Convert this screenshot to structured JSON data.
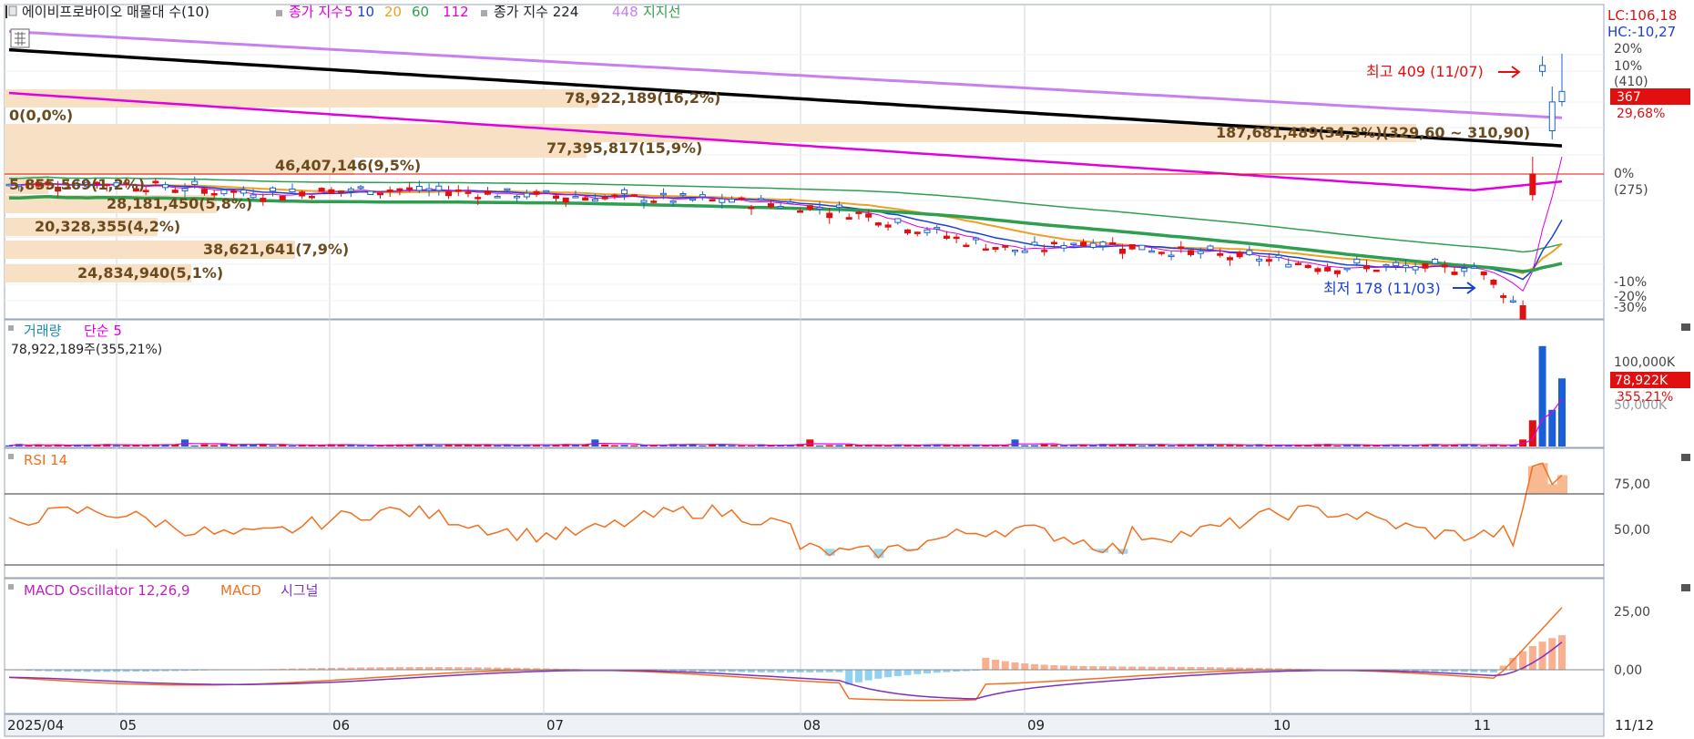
{
  "header": {
    "stock_name": "에이비프로바이오 매물대 수(10)",
    "ma_label": "종가 지수",
    "ma_periods": [
      "5",
      "10",
      "20",
      "60",
      "112"
    ],
    "ma_colors": [
      "#e000e0",
      "#1b3fd6",
      "#f0a020",
      "#2e9f4e",
      "#e000e0"
    ],
    "ma2_label": "종가 지수 224",
    "ma2_extra": "448",
    "support_label": "지지선",
    "lc": "LC:106,18",
    "hc": "HC:-10,27"
  },
  "colors": {
    "up": "#e01010",
    "down": "#1b5fd6",
    "grid": "#d0d6e0",
    "volume_profile": "#f7e0c4",
    "ma5": "#e000e0",
    "ma10": "#1b3fd6",
    "ma20": "#f0a020",
    "ma60": "#2e9f4e",
    "ma112": "#e000e0",
    "ma224": "#000000",
    "ma448": "#c880f0",
    "support": "#2e9f4e",
    "rsi": "#f07020",
    "macd": "#f07020",
    "signal": "#8030c0",
    "osc_pos": "#f8b090",
    "osc_neg": "#90d0f0"
  },
  "price_panel": {
    "volume_profile": [
      {
        "label": "0(0,0%)",
        "value": 0
      },
      {
        "label": "78,922,189(16,2%)",
        "value": 78922189
      },
      {
        "label": "187,681,489(34,3%)(329,60 ~ 310,90)",
        "value": 187681489
      },
      {
        "label": "77,395,817(15,9%)",
        "value": 77395817
      },
      {
        "label": "46,407,146(9,5%)",
        "value": 46407146
      },
      {
        "label": "5,855,569(1,2%)",
        "value": 5855569
      },
      {
        "label": "28,181,450(5,8%)",
        "value": 28181450
      },
      {
        "label": "20,328,355(4,2%)",
        "value": 20328355
      },
      {
        "label": "38,621,641(7,9%)",
        "value": 38621641
      },
      {
        "label": "24,834,940(5,1%)",
        "value": 24834940
      }
    ],
    "high_marker": "최고 409 (11/07)",
    "low_marker": "최저 178 (11/03)",
    "axis_labels": [
      "20%",
      "10%",
      "(410)",
      "29,68%",
      "0%",
      "(275)",
      "-10%",
      "-20%",
      "-30%"
    ],
    "current_price": "367"
  },
  "volume_panel": {
    "title": "거래량",
    "ma_label": "단순 5",
    "summary": "78,922,189주(355,21%)",
    "axis_top": "100,000K",
    "axis_hidden": "50,000K",
    "current_badge": "78,922K",
    "current_pct": "355,21%"
  },
  "rsi_panel": {
    "title": "RSI 14",
    "levels": [
      "75,00",
      "50,00"
    ]
  },
  "macd_panel": {
    "title": "MACD Oscillator 12,26,9",
    "macd_label": "MACD",
    "signal_label": "시그널",
    "levels": [
      "25,00",
      "0,00"
    ]
  },
  "x_axis": {
    "labels": [
      "2025/04",
      "05",
      "06",
      "07",
      "08",
      "09",
      "10",
      "11"
    ],
    "end_label": "11/12"
  },
  "chart_data": {
    "type": "candlestick",
    "title": "에이비프로바이오",
    "dates": [
      "2025/04",
      "05",
      "06",
      "07",
      "08",
      "09",
      "10",
      "11",
      "11/12"
    ],
    "price_range": [
      170,
      410
    ],
    "price_high": {
      "value": 409,
      "date": "11/07"
    },
    "price_low": {
      "value": 178,
      "date": "11/03"
    },
    "last_close": 367,
    "volume_profile_values": [
      0,
      78922189,
      187681489,
      77395817,
      46407146,
      5855569,
      28181450,
      20328355,
      38621641,
      24834940
    ],
    "volume_last": 78922189,
    "rsi_levels": [
      75,
      50
    ],
    "macd_levels": [
      25,
      0
    ]
  }
}
